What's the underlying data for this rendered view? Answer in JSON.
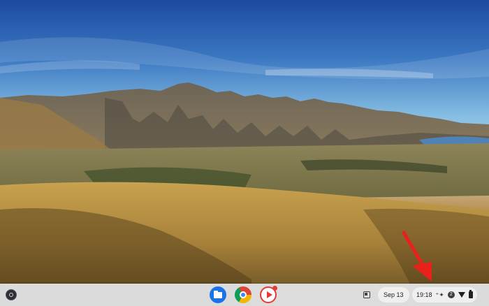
{
  "desktop": {
    "wallpaper": "mountain-landscape-wallpaper",
    "annotation_color": "#e8211a"
  },
  "shelf": {
    "launcher_icon": "launcher-icon",
    "apps": [
      {
        "name": "files-app-icon"
      },
      {
        "name": "chrome-app-icon"
      },
      {
        "name": "youtube-music-app-icon"
      }
    ],
    "date": "Sep 13",
    "time": "19:18",
    "badge_text": "2"
  },
  "colors": {
    "shelf_bg": "#e6e8ec",
    "files": "#1a73e8",
    "youtube": "#e53935"
  }
}
